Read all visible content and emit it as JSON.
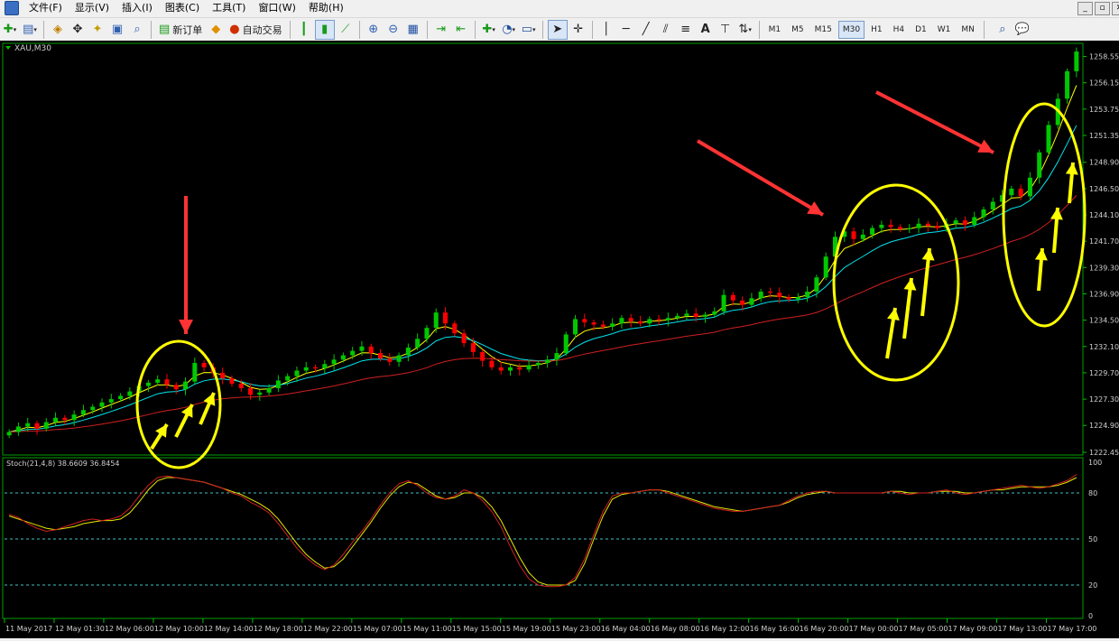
{
  "menu": {
    "items": [
      "文件(F)",
      "显示(V)",
      "插入(I)",
      "图表(C)",
      "工具(T)",
      "窗口(W)",
      "帮助(H)"
    ],
    "window_controls": [
      "_",
      "▫",
      "✕"
    ]
  },
  "toolbar": {
    "new_order_label": "新订单",
    "auto_trading_label": "自动交易",
    "timeframes": [
      "M1",
      "M5",
      "M15",
      "M30",
      "H1",
      "H4",
      "D1",
      "W1",
      "MN"
    ],
    "active_timeframe": "M30"
  },
  "chart": {
    "symbol_label": "XAU,M30",
    "price_axis": [
      "1258.55",
      "1256.15",
      "1253.75",
      "1251.35",
      "1248.90",
      "1246.50",
      "1244.10",
      "1241.70",
      "1239.30",
      "1236.90",
      "1234.50",
      "1232.10",
      "1229.70",
      "1227.30",
      "1224.90",
      "1222.45"
    ],
    "indicator_label": "Stoch(21,4,8) 38.6609 36.8454",
    "indicator_axis": [
      "100",
      "80",
      "50",
      "20",
      "0"
    ],
    "time_axis": [
      "11 May 2017",
      "12 May 01:30",
      "12 May 06:00",
      "12 May 10:00",
      "12 May 14:00",
      "12 May 18:00",
      "12 May 22:00",
      "15 May 07:00",
      "15 May 11:00",
      "15 May 15:00",
      "15 May 19:00",
      "15 May 23:00",
      "16 May 04:00",
      "16 May 08:00",
      "16 May 12:00",
      "16 May 16:00",
      "16 May 20:00",
      "17 May 00:00",
      "17 May 05:00",
      "17 May 09:00",
      "17 May 13:00",
      "17 May 17:00"
    ],
    "colors": {
      "background": "#000000",
      "bull": "#00c800",
      "bear": "#ff0000",
      "ma_fast": "#ffff00",
      "ma_mid": "#00e5ee",
      "ma_slow": "#d02020",
      "stoch_main": "#d02020",
      "stoch_signal": "#e8e800",
      "annotation_circle": "#ffff00",
      "annotation_arrow": "#ff3333",
      "small_arrow": "#ffff00"
    }
  },
  "chart_data": {
    "type": "candlestick",
    "symbol": "XAU",
    "timeframe": "M30",
    "ylim": [
      1222.45,
      1259.5
    ],
    "closes": [
      1224.3,
      1224.8,
      1225.1,
      1224.6,
      1225.2,
      1225.6,
      1225.4,
      1225.9,
      1226.3,
      1226.6,
      1227.0,
      1227.3,
      1227.6,
      1228.0,
      1228.5,
      1228.8,
      1229.1,
      1228.6,
      1228.2,
      1228.9,
      1230.6,
      1230.2,
      1229.7,
      1229.2,
      1228.7,
      1228.3,
      1227.7,
      1227.9,
      1228.3,
      1229.0,
      1229.4,
      1229.9,
      1230.2,
      1230.1,
      1230.5,
      1230.9,
      1231.3,
      1231.7,
      1232.1,
      1231.5,
      1231.0,
      1230.7,
      1231.3,
      1232.0,
      1232.8,
      1233.8,
      1235.2,
      1234.2,
      1233.3,
      1232.4,
      1231.6,
      1230.8,
      1230.2,
      1229.9,
      1230.2,
      1230.0,
      1230.4,
      1230.6,
      1230.9,
      1231.5,
      1233.2,
      1234.6,
      1234.3,
      1234.1,
      1233.9,
      1234.2,
      1234.7,
      1234.4,
      1234.2,
      1234.6,
      1234.5,
      1234.7,
      1234.9,
      1235.1,
      1234.8,
      1235.0,
      1235.3,
      1236.8,
      1236.3,
      1235.9,
      1236.5,
      1237.1,
      1237.0,
      1236.6,
      1236.4,
      1236.6,
      1237.1,
      1238.4,
      1240.3,
      1242.1,
      1242.6,
      1241.9,
      1242.3,
      1242.9,
      1243.2,
      1243.0,
      1242.8,
      1242.9,
      1243.3,
      1243.1,
      1242.9,
      1243.3,
      1243.6,
      1243.2,
      1243.9,
      1244.6,
      1245.3,
      1245.9,
      1246.5,
      1245.8,
      1247.5,
      1249.8,
      1252.3,
      1254.7,
      1257.2,
      1259.0
    ],
    "stoch_main": [
      66,
      64,
      60,
      57,
      55,
      56,
      58,
      60,
      62,
      63,
      62,
      63,
      65,
      70,
      78,
      85,
      90,
      91,
      90,
      89,
      88,
      87,
      85,
      83,
      80,
      78,
      74,
      71,
      67,
      60,
      52,
      44,
      38,
      33,
      30,
      33,
      40,
      48,
      55,
      63,
      72,
      80,
      86,
      88,
      85,
      80,
      77,
      76,
      78,
      82,
      80,
      75,
      68,
      58,
      45,
      33,
      24,
      20,
      19,
      19,
      20,
      25,
      37,
      53,
      68,
      78,
      80,
      80,
      81,
      82,
      82,
      80,
      78,
      76,
      74,
      72,
      70,
      69,
      68,
      68,
      69,
      70,
      71,
      72,
      75,
      78,
      80,
      81,
      81,
      80,
      80,
      80,
      80,
      80,
      80,
      81,
      80,
      79,
      80,
      80,
      81,
      82,
      80,
      79,
      80,
      81,
      82,
      83,
      84,
      85,
      84,
      83,
      84,
      86,
      88,
      92
    ],
    "stoch_signal": [
      65,
      63,
      61,
      59,
      57,
      56,
      57,
      58,
      60,
      61,
      62,
      62,
      63,
      67,
      74,
      82,
      88,
      90,
      90,
      89,
      88,
      87,
      85,
      83,
      81,
      79,
      76,
      73,
      69,
      63,
      55,
      47,
      40,
      35,
      31,
      32,
      37,
      45,
      53,
      61,
      70,
      78,
      84,
      87,
      86,
      82,
      78,
      76,
      77,
      80,
      80,
      77,
      71,
      62,
      50,
      38,
      28,
      22,
      20,
      20,
      20,
      23,
      34,
      50,
      65,
      76,
      79,
      80,
      81,
      82,
      82,
      81,
      79,
      77,
      75,
      73,
      71,
      70,
      69,
      68,
      69,
      70,
      71,
      72,
      74,
      77,
      79,
      80,
      81,
      80,
      80,
      80,
      80,
      80,
      80,
      81,
      81,
      80,
      80,
      80,
      81,
      81,
      81,
      80,
      80,
      81,
      82,
      82,
      83,
      84,
      84,
      84,
      84,
      85,
      87,
      90
    ],
    "indicator": {
      "name": "Stoch",
      "params": [
        21,
        4,
        8
      ],
      "main": 38.6609,
      "signal": 36.8454,
      "levels": [
        20,
        50,
        80
      ],
      "ylim": [
        0,
        100
      ]
    }
  }
}
